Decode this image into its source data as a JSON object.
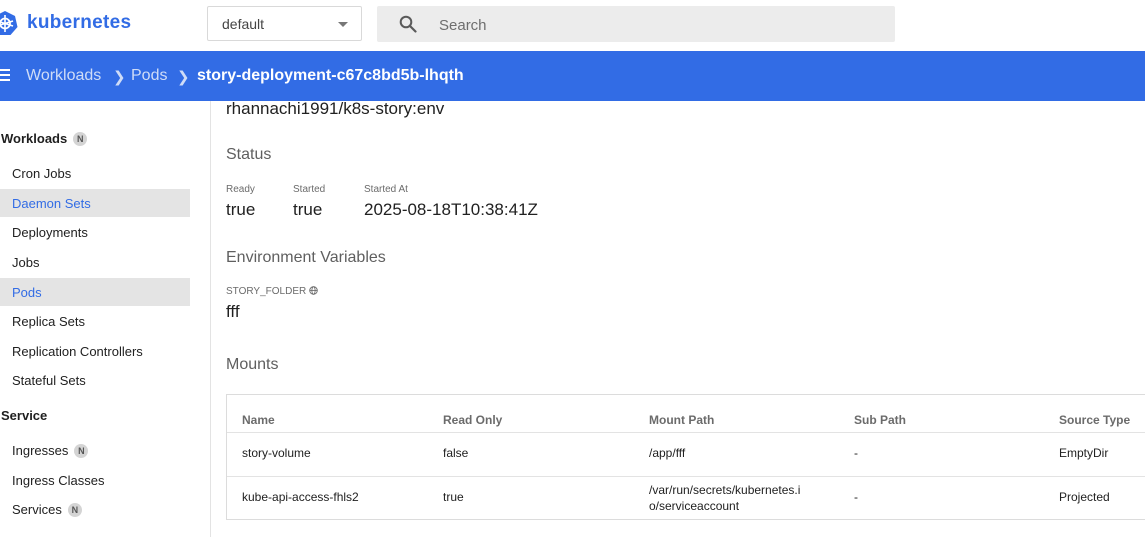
{
  "header": {
    "brand": "kubernetes",
    "namespace": {
      "selected": "default"
    },
    "search": {
      "placeholder": "Search",
      "value": ""
    }
  },
  "breadcrumb": {
    "items": [
      "Workloads",
      "Pods",
      "story-deployment-c67c8bd5b-lhqth"
    ],
    "separator": ">"
  },
  "sidebar": {
    "workloads_header": "Workloads",
    "workloads_badge": "N",
    "workloads_items": [
      {
        "label": "Cron Jobs",
        "active": false
      },
      {
        "label": "Daemon Sets",
        "active": true
      },
      {
        "label": "Deployments",
        "active": false
      },
      {
        "label": "Jobs",
        "active": false
      },
      {
        "label": "Pods",
        "active": true
      },
      {
        "label": "Replica Sets",
        "active": false
      },
      {
        "label": "Replication Controllers",
        "active": false
      },
      {
        "label": "Stateful Sets",
        "active": false
      }
    ],
    "service_header": "Service",
    "service_items": [
      {
        "label": "Ingresses",
        "badge": "N"
      },
      {
        "label": "Ingress Classes",
        "badge": ""
      },
      {
        "label": "Services",
        "badge": "N"
      }
    ]
  },
  "main": {
    "image": "rhannachi1991/k8s-story:env",
    "status": {
      "title": "Status",
      "fields": [
        {
          "label": "Ready",
          "value": "true"
        },
        {
          "label": "Started",
          "value": "true"
        },
        {
          "label": "Started At",
          "value": "2025-08-18T10:38:41Z"
        }
      ]
    },
    "env": {
      "title": "Environment Variables",
      "name": "STORY_FOLDER",
      "value": "fff"
    },
    "mounts": {
      "title": "Mounts",
      "columns": [
        "Name",
        "Read Only",
        "Mount Path",
        "Sub Path",
        "Source Type"
      ],
      "rows": [
        [
          "story-volume",
          "false",
          "/app/fff",
          "-",
          "EmptyDir"
        ],
        [
          "kube-api-access-fhls2",
          "true",
          "/var/run/secrets/kubernetes.io/serviceaccount",
          "-",
          "Projected"
        ]
      ]
    }
  },
  "colors": {
    "primary": "#326ce5",
    "active_bg": "#e4e4e4"
  },
  "icons": {
    "logo": "kubernetes-helm-icon",
    "search": "search-icon",
    "menu": "menu-icon",
    "env": "globe-icon"
  }
}
